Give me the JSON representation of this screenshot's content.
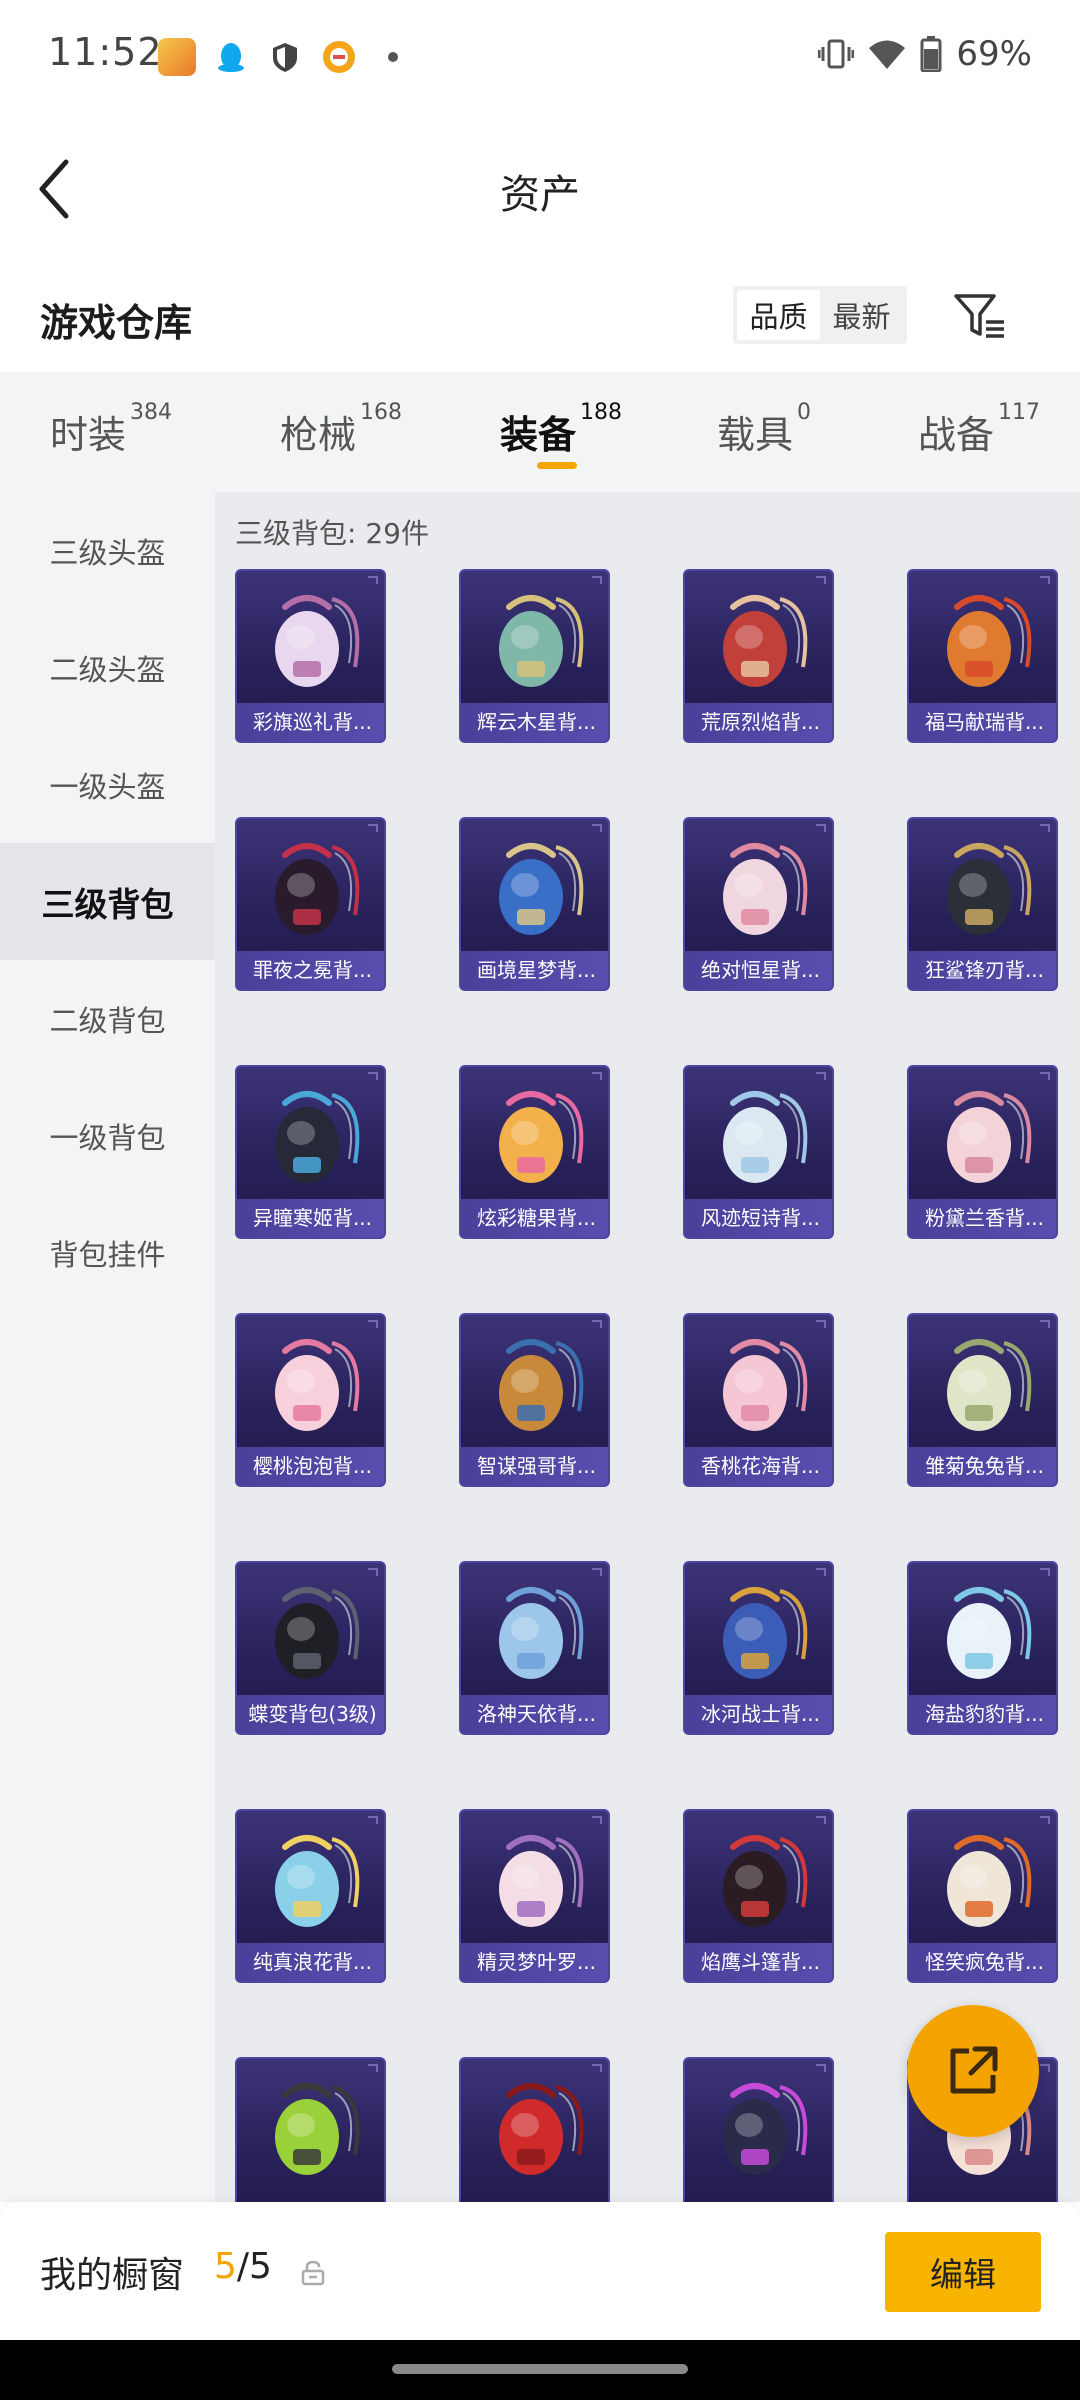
{
  "status_bar": {
    "time": "11:52",
    "battery": "69%",
    "icons": [
      "app-game-icon",
      "qq-icon",
      "shield-icon",
      "ring-app-icon",
      "vibrate-icon",
      "wifi-icon",
      "battery-icon"
    ]
  },
  "header": {
    "title": "资产"
  },
  "section": {
    "title": "游戏仓库",
    "sort_options": [
      "品质",
      "最新"
    ]
  },
  "tabs": [
    {
      "label": "时装",
      "count": "384"
    },
    {
      "label": "枪械",
      "count": "168"
    },
    {
      "label": "装备",
      "count": "188",
      "active": true
    },
    {
      "label": "载具",
      "count": "0"
    },
    {
      "label": "战备",
      "count": "117"
    }
  ],
  "sidebar": {
    "items": [
      {
        "label": "三级头盔"
      },
      {
        "label": "二级头盔"
      },
      {
        "label": "一级头盔"
      },
      {
        "label": "三级背包",
        "active": true
      },
      {
        "label": "二级背包"
      },
      {
        "label": "一级背包"
      },
      {
        "label": "背包挂件"
      }
    ]
  },
  "content": {
    "header": "三级背包: 29件",
    "items": [
      {
        "name": "彩旗巡礼背...",
        "color": "#e8d7ee",
        "accent": "#b46fa8"
      },
      {
        "name": "辉云木星背...",
        "color": "#7fb7a8",
        "accent": "#d6c27a"
      },
      {
        "name": "荒原烈焰背...",
        "color": "#c2403a",
        "accent": "#e6c2a0"
      },
      {
        "name": "福马献瑞背...",
        "color": "#e07a2f",
        "accent": "#d84b2a"
      },
      {
        "name": "罪夜之冕背...",
        "color": "#2a1b2c",
        "accent": "#c2314a"
      },
      {
        "name": "画境星梦背...",
        "color": "#3a6fc8",
        "accent": "#d9c48a"
      },
      {
        "name": "绝对恒星背...",
        "color": "#f0d6df",
        "accent": "#e08aa0"
      },
      {
        "name": "狂鲨锋刃背...",
        "color": "#2a2f38",
        "accent": "#c9a760"
      },
      {
        "name": "异瞳寒姬背...",
        "color": "#262a38",
        "accent": "#4aa8d8"
      },
      {
        "name": "炫彩糖果背...",
        "color": "#f2b14a",
        "accent": "#e86aa0"
      },
      {
        "name": "风迹短诗背...",
        "color": "#dbe8f2",
        "accent": "#9ec8e6"
      },
      {
        "name": "粉黛兰香背...",
        "color": "#f3d2d8",
        "accent": "#d88aa0"
      },
      {
        "name": "樱桃泡泡背...",
        "color": "#f8d0dc",
        "accent": "#e57aa0"
      },
      {
        "name": "智谋强哥背...",
        "color": "#c88a3a",
        "accent": "#3a6fb0"
      },
      {
        "name": "香桃花海背...",
        "color": "#f5c6d4",
        "accent": "#e28aa6"
      },
      {
        "name": "雏菊兔兔背...",
        "color": "#dfe6c8",
        "accent": "#9aa870"
      },
      {
        "name": "蝶变背包(3级)",
        "color": "#1f1f26",
        "accent": "#5f6070"
      },
      {
        "name": "洛神天依背...",
        "color": "#9cc6ea",
        "accent": "#6fa0d8"
      },
      {
        "name": "冰河战士背...",
        "color": "#3b5db8",
        "accent": "#d9a23a"
      },
      {
        "name": "海盐豹豹背...",
        "color": "#e8f2f8",
        "accent": "#7fc8e6"
      },
      {
        "name": "纯真浪花背...",
        "color": "#8ad0e8",
        "accent": "#f0d060"
      },
      {
        "name": "精灵梦叶罗...",
        "color": "#f5dde6",
        "accent": "#a06fc0"
      },
      {
        "name": "焰鹰斗篷背...",
        "color": "#2a1c22",
        "accent": "#d23a3a"
      },
      {
        "name": "怪笑疯兔背...",
        "color": "#f0e6d8",
        "accent": "#e06a2a"
      },
      {
        "name": "",
        "color": "#9ad03a",
        "accent": "#3a3a3a"
      },
      {
        "name": "",
        "color": "#d02a2a",
        "accent": "#8a1a1a"
      },
      {
        "name": "",
        "color": "#2a2a4a",
        "accent": "#c84ad8"
      },
      {
        "name": "",
        "color": "#f5e0d6",
        "accent": "#d88a8a"
      }
    ]
  },
  "bottom_bar": {
    "label": "我的橱窗",
    "count_current": "5",
    "count_total": "/5",
    "edit_label": "编辑"
  },
  "colors": {
    "accent": "#f5a600",
    "card_bg": "#28215a",
    "card_label": "#5a4fb0"
  }
}
